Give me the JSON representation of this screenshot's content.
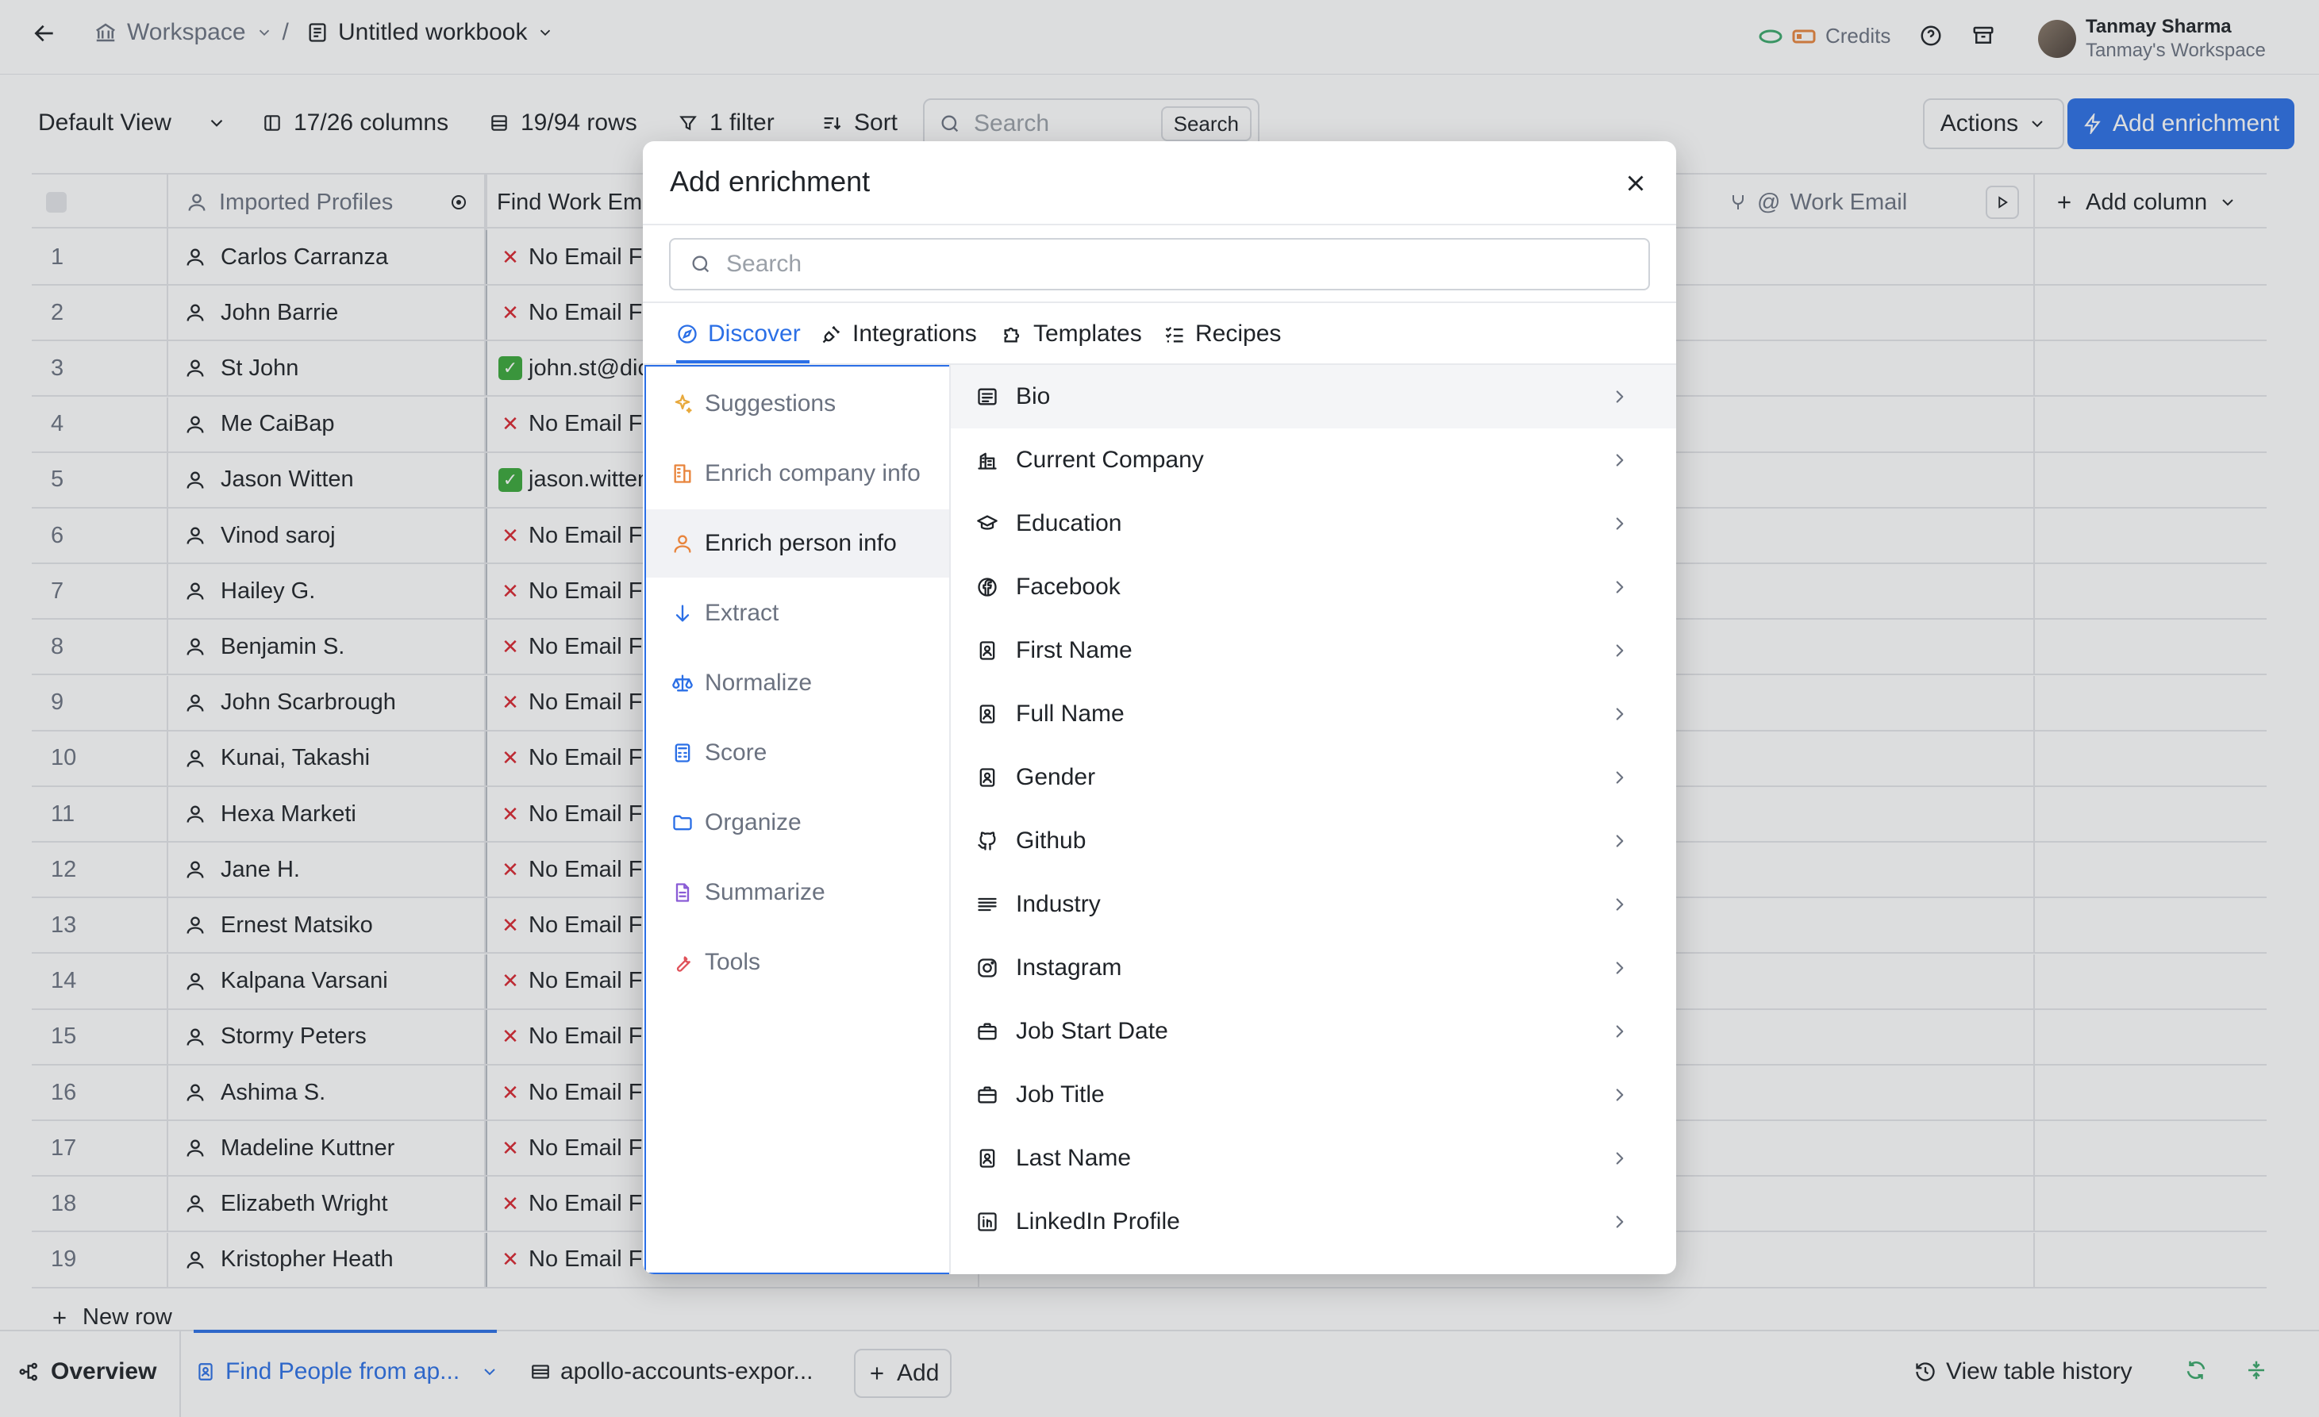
{
  "header": {
    "workspace_label": "Workspace",
    "separator": "/",
    "workbook_title": "Untitled workbook",
    "credits_label": "Credits",
    "user_name": "Tanmay Sharma",
    "user_workspace": "Tanmay's Workspace"
  },
  "toolbar": {
    "view_label": "Default View",
    "columns_label": "17/26 columns",
    "rows_label": "19/94 rows",
    "filter_label": "1 filter",
    "sort_label": "Sort",
    "search_placeholder": "Search",
    "search_button": "Search",
    "actions_label": "Actions",
    "add_enrichment_label": "Add enrichment"
  },
  "table": {
    "columns": {
      "imported_profiles": "Imported Profiles",
      "find_work_email": "Find Work Em",
      "work_email": "Work Email",
      "add_column": "Add column"
    },
    "rows": [
      {
        "num": "1",
        "name": "Carlos Carranza",
        "status": "no",
        "email": "No Email Fo"
      },
      {
        "num": "2",
        "name": "John Barrie",
        "status": "no",
        "email": "No Email Fo"
      },
      {
        "num": "3",
        "name": "St John",
        "status": "ok",
        "email": "john.st@dic"
      },
      {
        "num": "4",
        "name": "Me CaiBap",
        "status": "no",
        "email": "No Email Fo"
      },
      {
        "num": "5",
        "name": "Jason Witten",
        "status": "ok",
        "email": "jason.witten"
      },
      {
        "num": "6",
        "name": "Vinod saroj",
        "status": "no",
        "email": "No Email Fo"
      },
      {
        "num": "7",
        "name": "Hailey G.",
        "status": "no",
        "email": "No Email Fo"
      },
      {
        "num": "8",
        "name": "Benjamin S.",
        "status": "no",
        "email": "No Email Fo"
      },
      {
        "num": "9",
        "name": "John Scarbrough",
        "status": "no",
        "email": "No Email Fo"
      },
      {
        "num": "10",
        "name": "Kunai, Takashi",
        "status": "no",
        "email": "No Email Fo"
      },
      {
        "num": "11",
        "name": "Hexa Marketi",
        "status": "no",
        "email": "No Email Fo"
      },
      {
        "num": "12",
        "name": "Jane H.",
        "status": "no",
        "email": "No Email Fo"
      },
      {
        "num": "13",
        "name": "Ernest Matsiko",
        "status": "no",
        "email": "No Email Fo"
      },
      {
        "num": "14",
        "name": "Kalpana Varsani",
        "status": "no",
        "email": "No Email Fo"
      },
      {
        "num": "15",
        "name": "Stormy Peters",
        "status": "no",
        "email": "No Email Fo"
      },
      {
        "num": "16",
        "name": "Ashima S.",
        "status": "no",
        "email": "No Email Fo"
      },
      {
        "num": "17",
        "name": "Madeline Kuttner",
        "status": "no",
        "email": "No Email Fo"
      },
      {
        "num": "18",
        "name": "Elizabeth Wright",
        "status": "no",
        "email": "No Email Fo"
      },
      {
        "num": "19",
        "name": "Kristopher Heath",
        "status": "no",
        "email": "No Email Fo"
      }
    ],
    "new_row_label": "New row"
  },
  "bottom": {
    "overview_label": "Overview",
    "find_people_tab": "Find People from ap...",
    "apollo_tab": "apollo-accounts-expor...",
    "add_label": "Add",
    "history_label": "View table history"
  },
  "modal": {
    "title": "Add enrichment",
    "search_placeholder": "Search",
    "tabs": {
      "discover": "Discover",
      "integrations": "Integrations",
      "templates": "Templates",
      "recipes": "Recipes"
    },
    "categories": [
      {
        "label": "Suggestions",
        "icon": "sparkle-icon",
        "color": "#e8a93c"
      },
      {
        "label": "Enrich company info",
        "icon": "building-icon",
        "color": "#e8843c"
      },
      {
        "label": "Enrich person info",
        "icon": "person-icon",
        "color": "#e8843c"
      },
      {
        "label": "Extract",
        "icon": "arrow-down-icon",
        "color": "#2b6fe6"
      },
      {
        "label": "Normalize",
        "icon": "scale-icon",
        "color": "#2b6fe6"
      },
      {
        "label": "Score",
        "icon": "calculator-icon",
        "color": "#2b6fe6"
      },
      {
        "label": "Organize",
        "icon": "folder-icon",
        "color": "#2b6fe6"
      },
      {
        "label": "Summarize",
        "icon": "document-icon",
        "color": "#8a5cd6"
      },
      {
        "label": "Tools",
        "icon": "wrench-icon",
        "color": "#e0525a"
      }
    ],
    "items": [
      {
        "label": "Bio",
        "icon": "text-icon"
      },
      {
        "label": "Current Company",
        "icon": "company-icon"
      },
      {
        "label": "Education",
        "icon": "graduation-cap-icon"
      },
      {
        "label": "Facebook",
        "icon": "facebook-icon"
      },
      {
        "label": "First Name",
        "icon": "id-badge-icon"
      },
      {
        "label": "Full Name",
        "icon": "id-badge-icon"
      },
      {
        "label": "Gender",
        "icon": "id-badge-icon"
      },
      {
        "label": "Github",
        "icon": "github-icon"
      },
      {
        "label": "Industry",
        "icon": "lines-icon"
      },
      {
        "label": "Instagram",
        "icon": "instagram-icon"
      },
      {
        "label": "Job Start Date",
        "icon": "briefcase-icon"
      },
      {
        "label": "Job Title",
        "icon": "briefcase-icon"
      },
      {
        "label": "Last Name",
        "icon": "id-badge-icon"
      },
      {
        "label": "LinkedIn Profile",
        "icon": "linkedin-icon"
      }
    ]
  },
  "colors": {
    "accent": "#2b6fe6",
    "error": "#d9252f",
    "success": "#3aa83a",
    "credit_green": "#3aa86b",
    "credit_orange": "#e8843c"
  }
}
